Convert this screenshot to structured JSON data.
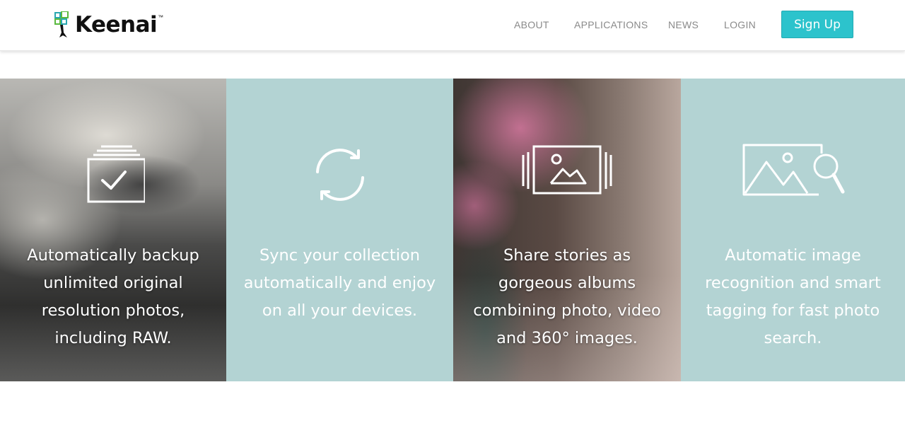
{
  "brand": {
    "name": "Keenai",
    "trademark": "™",
    "logo_colors": [
      "#2aa7b0",
      "#5ab93f",
      "#111111"
    ]
  },
  "nav": {
    "about": "ABOUT",
    "applications": "APPLICATIONS",
    "news": "NEWS",
    "login": "LOGIN",
    "signup": "Sign Up"
  },
  "colors": {
    "accent": "#2cc3cc",
    "tile_teal": "#b3d3d3",
    "nav_text": "#8a8a8a"
  },
  "features": [
    {
      "icon": "stacked-check-icon",
      "background": "cloudy-mountain-photo",
      "text": "Automatically backup unlimited original resolution photos, including RAW."
    },
    {
      "icon": "sync-icon",
      "background": "teal",
      "text": "Sync your collection automatically and enjoy on all your devices."
    },
    {
      "icon": "photo-album-icon",
      "background": "pink-flowers-photo",
      "text": "Share stories as gorgeous albums combining photo, video and 360° images."
    },
    {
      "icon": "image-search-icon",
      "background": "teal",
      "text": "Automatic image recognition and smart tagging for fast photo search."
    }
  ]
}
